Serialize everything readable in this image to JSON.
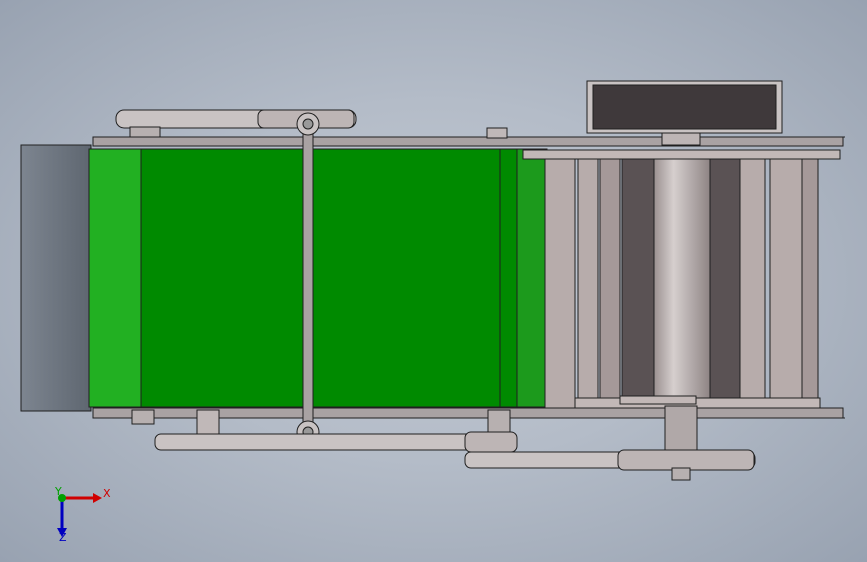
{
  "viewport": {
    "background_center": "#c3c9d3",
    "background_edge": "#98a2b1"
  },
  "model": {
    "belt_color": "#008a00",
    "belt_highlight": "#22b022",
    "frame_color": "#b7acab",
    "frame_dark": "#8b8080",
    "motor_color": "#3f393b",
    "edge_color": "#1f1f1f"
  },
  "triad": {
    "x_label": "X",
    "y_label": "Y",
    "z_label": "Z",
    "x_color": "#d00000",
    "y_color": "#00a000",
    "z_color": "#0000c0"
  }
}
